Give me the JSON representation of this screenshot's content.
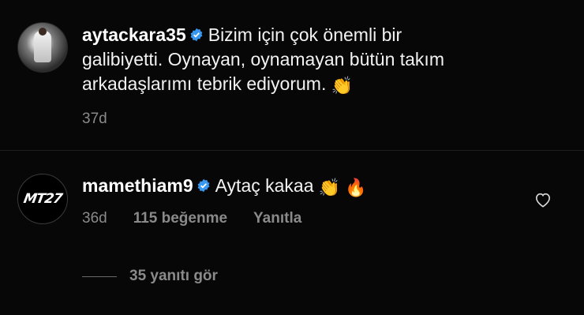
{
  "comments": [
    {
      "username": "aytackara35",
      "text": "Bizim için çok önemli bir galibiyetti. Oynayan, oynamayan bütün takım arkadaşlarımı tebrik ediyorum.",
      "emoji": "👏",
      "time": "37d"
    },
    {
      "username": "mamethiam9",
      "text": "Aytaç kakaa",
      "emoji": "👏 🔥",
      "avatar_logo": "MT27",
      "time": "36d",
      "likes": "115 beğenme",
      "reply_label": "Yanıtla",
      "view_replies": "35 yanıtı gör"
    }
  ],
  "colors": {
    "background": "#070707",
    "verified": "#3897f0",
    "meta": "#8a8a8a"
  },
  "icons": [
    "verified-badge-icon",
    "heart-icon"
  ]
}
